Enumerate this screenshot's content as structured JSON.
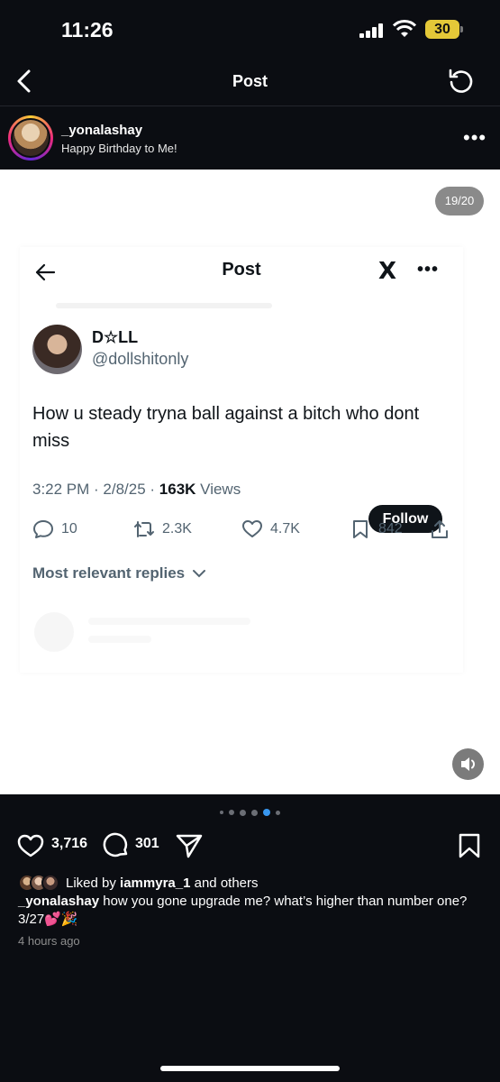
{
  "status_bar": {
    "time": "11:26",
    "battery": "30"
  },
  "nav": {
    "title": "Post"
  },
  "post_header": {
    "username": "_yonalashay",
    "caption": "Happy Birthday to Me!"
  },
  "media": {
    "counter": "19/20"
  },
  "tweet": {
    "title": "Post",
    "x_logo": "X",
    "name": "D☆LL",
    "handle": "@dollshitonly",
    "follow": "Follow",
    "text": "How u steady tryna ball against a bitch who dont miss",
    "meta_time": "3:22 PM · 2/8/25 · ",
    "meta_views_count": "163K",
    "meta_views_label": " Views",
    "replies": "10",
    "reposts": "2.3K",
    "likes": "4.7K",
    "bookmarks": "842",
    "most_relevant": "Most relevant replies"
  },
  "actions": {
    "likes": "3,716",
    "comments": "301"
  },
  "liked_by": {
    "prefix": "Liked by ",
    "user": "iammyra_1",
    "suffix": " and others"
  },
  "caption": {
    "user": "_yonalashay",
    "text": " how you gone upgrade me? what’s higher than number one? 3/27💕🎉"
  },
  "time_ago": "4 hours ago",
  "colors": {
    "background": "#0b0d12",
    "accent": "#3897f0",
    "battery": "#e4c838"
  }
}
